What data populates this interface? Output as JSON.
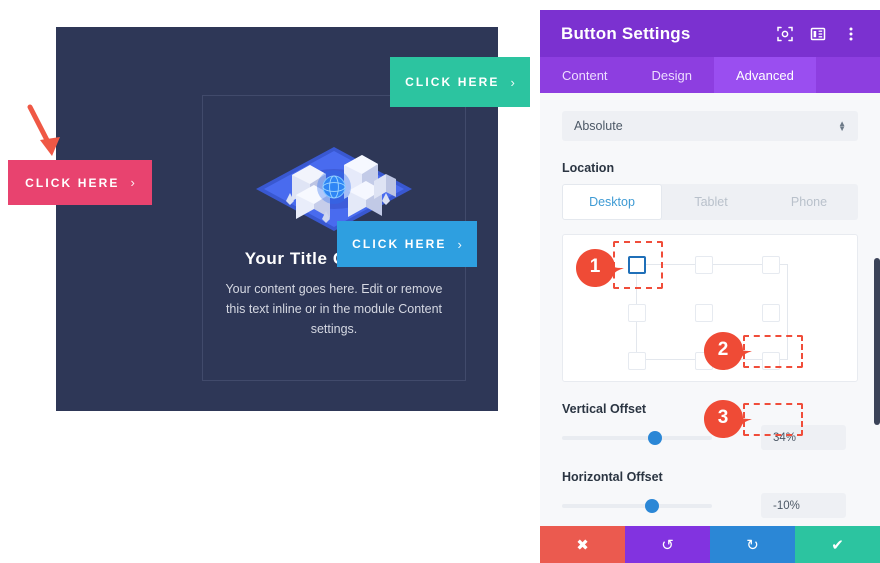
{
  "preview": {
    "title": "Your Title Goes Here",
    "body": "Your content goes here. Edit or remove this text inline or in the module Content settings.",
    "illustration_name": "isometric-city-illustration",
    "buttons": [
      {
        "label": "CLICK HERE",
        "chevron": "›",
        "color": "#e8436f",
        "name": "cta-pink"
      },
      {
        "label": "CLICK HERE",
        "chevron": "›",
        "color": "#2cc4a0",
        "name": "cta-green"
      },
      {
        "label": "CLICK HERE",
        "chevron": "›",
        "color": "#2e9fe0",
        "name": "cta-blue"
      }
    ],
    "section_bg": "#2e3757"
  },
  "panel": {
    "title": "Button Settings",
    "header_icons": [
      "focus-target-icon",
      "layout-panel-icon",
      "more-vertical-icon"
    ],
    "tabs": [
      {
        "label": "Content",
        "active": false
      },
      {
        "label": "Design",
        "active": false
      },
      {
        "label": "Advanced",
        "active": true
      }
    ],
    "position_select": {
      "value": "Absolute",
      "stepper_up": "▲",
      "stepper_down": "▼"
    },
    "location": {
      "label": "Location",
      "devices": [
        {
          "label": "Desktop",
          "active": true
        },
        {
          "label": "Tablet",
          "active": false
        },
        {
          "label": "Phone",
          "active": false
        }
      ],
      "selected_cell": "top-left"
    },
    "vertical_offset": {
      "label": "Vertical Offset",
      "value": "34%",
      "slider_percent": 62
    },
    "horizontal_offset": {
      "label": "Horizontal Offset",
      "value": "-10%",
      "slider_percent": 60
    },
    "footer": [
      {
        "icon": "✖",
        "color": "#eb5a4f",
        "name": "cancel-button"
      },
      {
        "icon": "↺",
        "color": "#8233e0",
        "name": "undo-button"
      },
      {
        "icon": "↻",
        "color": "#2b87d6",
        "name": "redo-button"
      },
      {
        "icon": "✔",
        "color": "#2cc4a0",
        "name": "save-button"
      }
    ]
  },
  "annotations": {
    "accent": "#f04d3a",
    "markers": [
      {
        "number": "1",
        "target": "position-grid-top-left-cell"
      },
      {
        "number": "2",
        "target": "vertical-offset-value"
      },
      {
        "number": "3",
        "target": "horizontal-offset-value"
      }
    ]
  }
}
